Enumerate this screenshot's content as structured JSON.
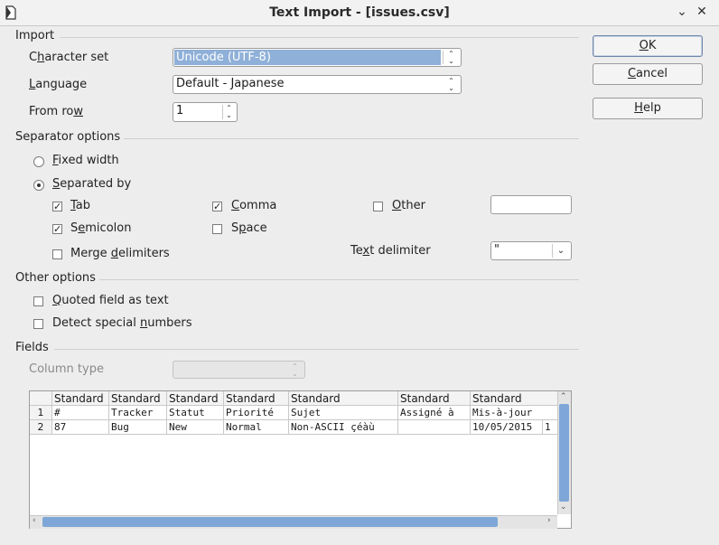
{
  "window": {
    "title": "Text Import - [issues.csv]",
    "minimize_glyph": "⌄",
    "close_glyph": "✕"
  },
  "sections": {
    "import": "Import",
    "separator_options": "Separator options",
    "other_options": "Other options",
    "fields": "Fields"
  },
  "import": {
    "charset_label_pre": "C",
    "charset_label_u": "h",
    "charset_label_post": "aracter set",
    "charset_value": "Unicode (UTF-8)",
    "language_label_u": "L",
    "language_label_post": "anguage",
    "language_value": "Default - Japanese",
    "fromrow_label_pre": "From ro",
    "fromrow_label_u": "w",
    "fromrow_value": "1"
  },
  "separator": {
    "fixed_u": "F",
    "fixed_post": "ixed width",
    "separated_u": "S",
    "separated_post": "eparated by",
    "tab_u": "T",
    "tab_post": "ab",
    "comma_u": "C",
    "comma_post": "omma",
    "other_u": "O",
    "other_post": "ther",
    "other_value": "",
    "semicolon_pre": "S",
    "semicolon_u": "e",
    "semicolon_post": "micolon",
    "space_pre": "S",
    "space_u": "p",
    "space_post": "ace",
    "merge_pre": "Merge ",
    "merge_u": "d",
    "merge_post": "elimiters",
    "textdelim_pre": "Te",
    "textdelim_u": "x",
    "textdelim_post": "t delimiter",
    "textdelim_value": "\"",
    "states": {
      "fixed": false,
      "separated": true,
      "tab": true,
      "comma": true,
      "other": false,
      "semicolon": true,
      "space": false,
      "merge": false
    }
  },
  "other_options": {
    "quoted_u": "Q",
    "quoted_post": "uoted field as text",
    "detect_pre": "Detect special ",
    "detect_u": "n",
    "detect_post": "umbers",
    "states": {
      "quoted": false,
      "detect": false
    }
  },
  "fields": {
    "column_type_label": "Column type",
    "column_type_value": ""
  },
  "preview": {
    "headers": [
      "Standard",
      "Standard",
      "Standard",
      "Standard",
      "Standard",
      "Standard",
      "Standard"
    ],
    "rows": [
      {
        "num": "1",
        "cells": [
          "#",
          "Tracker",
          "Statut",
          "Priorité",
          "Sujet",
          "Assigné à",
          "Mis-à-jour"
        ]
      },
      {
        "num": "2",
        "cells": [
          "87",
          "Bug",
          "New",
          "Normal",
          "Non-ASCII  çéàù",
          "",
          "10/05/2015"
        ]
      }
    ],
    "overflow_text": "1"
  },
  "buttons": {
    "ok_u": "O",
    "ok_post": "K",
    "cancel_u": "C",
    "cancel_post": "ancel",
    "help_u": "H",
    "help_post": "elp"
  }
}
